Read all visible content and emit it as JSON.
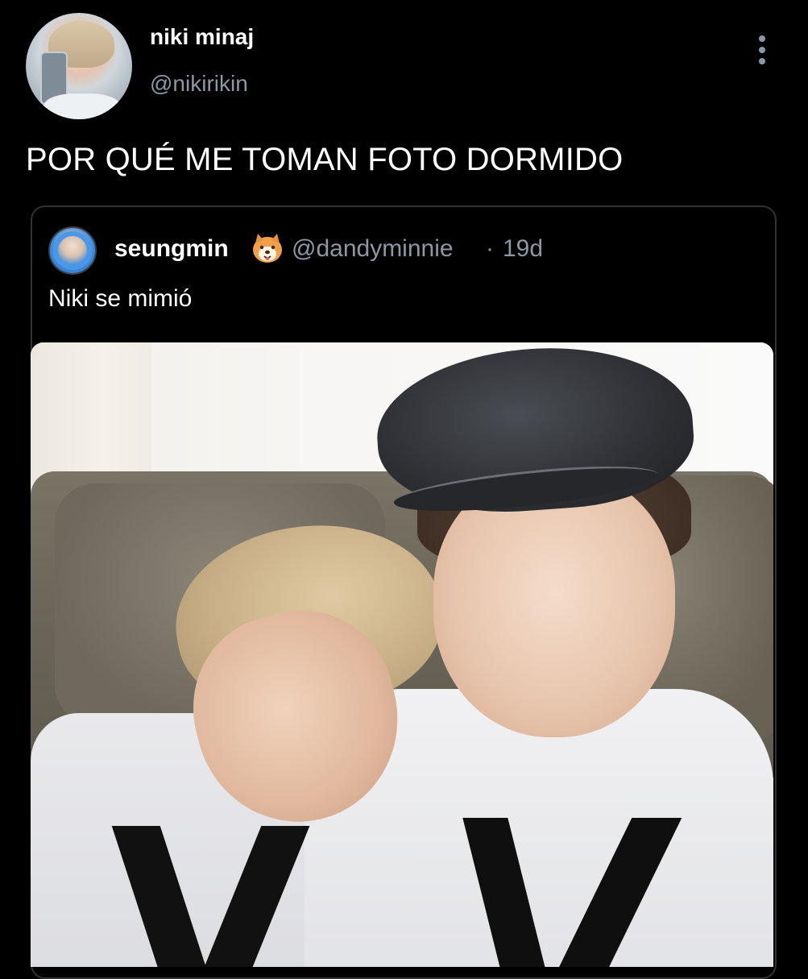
{
  "tweet": {
    "display_name": "niki minaj",
    "handle": "@nikirikin",
    "text": "POR QUÉ ME TOMAN FOTO DORMIDO",
    "avatar_icon": "profile-avatar",
    "more_icon": "more-vertical-icon"
  },
  "quote": {
    "display_name": "seungmin",
    "emoji_icon": "shiba-dog-emoji-icon",
    "handle": "@dandyminnie",
    "separator": "·",
    "time": "19d",
    "text": "Niki se mimió",
    "avatar_icon": "profile-avatar"
  },
  "colors": {
    "background": "#000000",
    "primary_text": "#ffffff",
    "secondary_text": "#8b98a5",
    "border": "#2f3336"
  }
}
